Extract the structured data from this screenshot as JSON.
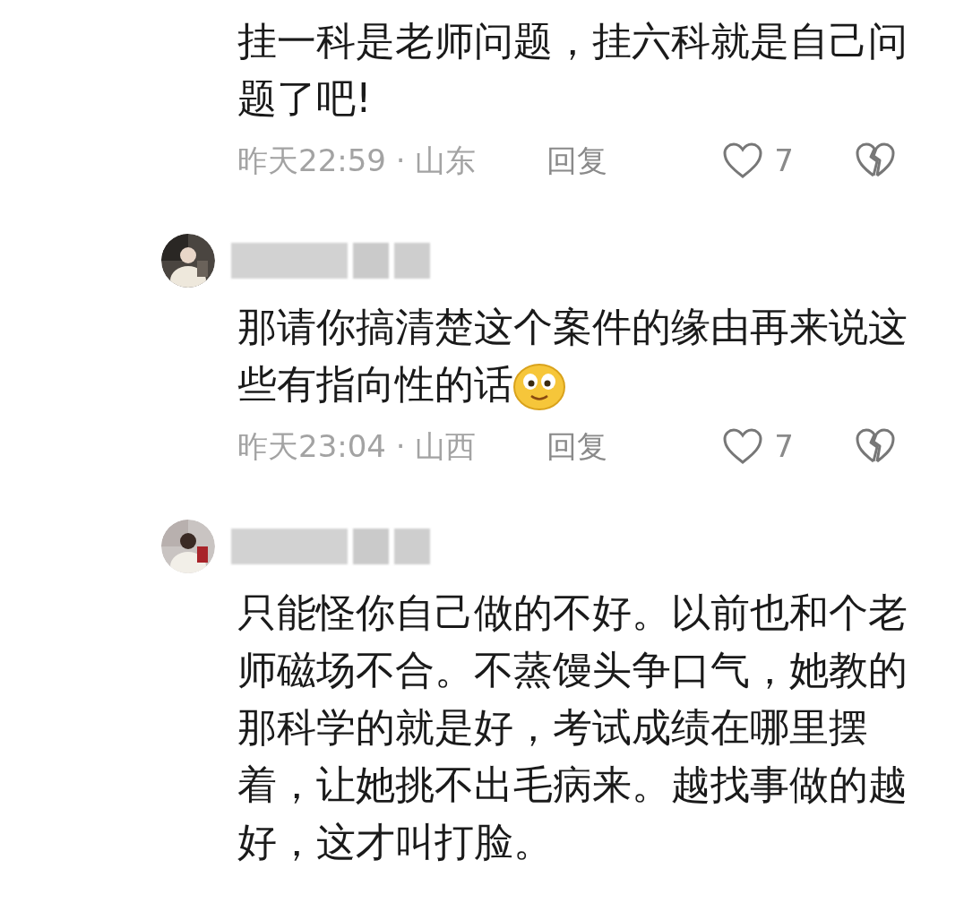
{
  "comments": [
    {
      "kind": "continued",
      "text": "挂一科是老师问题，挂六科就是自己问题了吧!",
      "meta": "昨天22:59 · 山东",
      "reply": "回复",
      "likes": "7"
    },
    {
      "kind": "full",
      "text": "那请你搞清楚这个案件的缘由再来说这些有指向性的话",
      "emoji": true,
      "meta": "昨天23:04 · 山西",
      "reply": "回复",
      "likes": "7"
    },
    {
      "kind": "full",
      "text": "只能怪你自己做的不好。以前也和个老师磁场不合。不蒸馒头争口气，她教的那科学的就是好，考试成绩在哪里摆着，让她挑不出毛病来。越找事做的越好，这才叫打脸。"
    }
  ]
}
